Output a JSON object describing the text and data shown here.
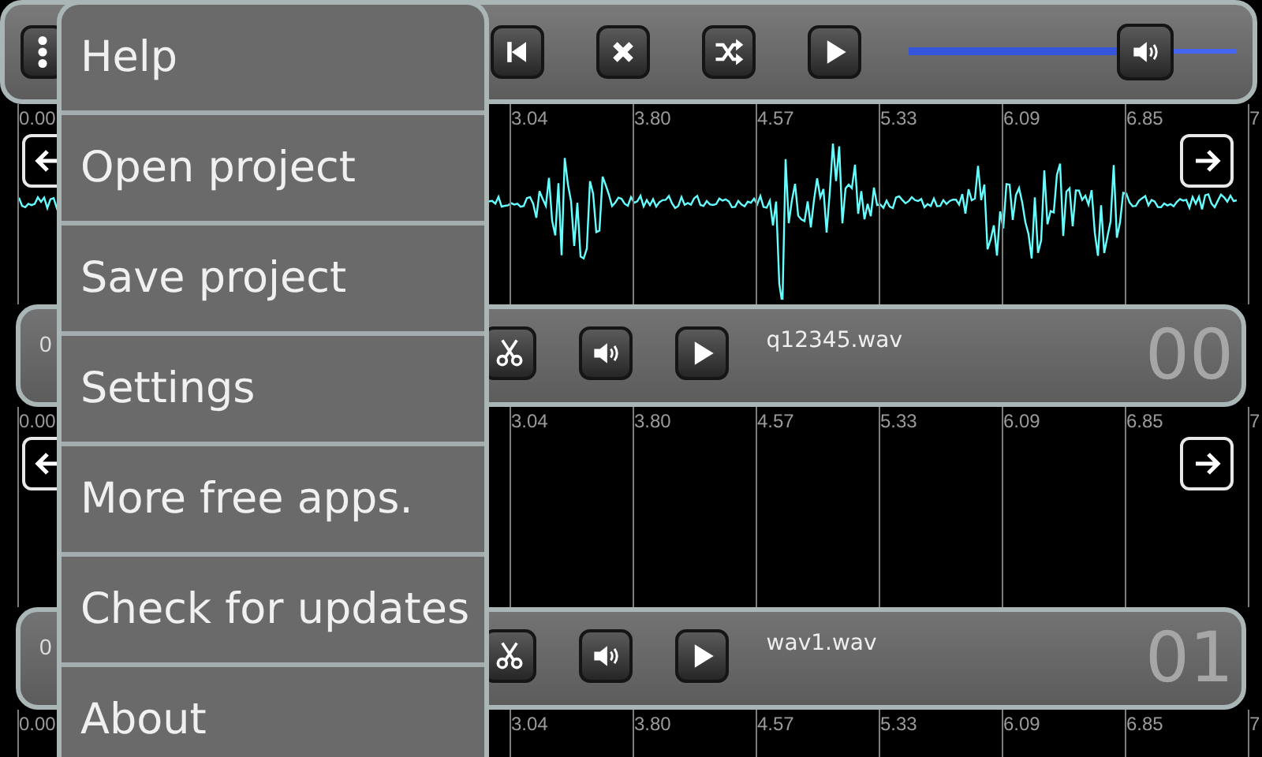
{
  "toolbar": {
    "buttons": [
      {
        "kind": "menu"
      },
      {
        "kind": "skip-back"
      },
      {
        "kind": "close"
      },
      {
        "kind": "shuffle"
      },
      {
        "kind": "play"
      }
    ],
    "volume": {
      "level": 0.72
    }
  },
  "sections": [
    {
      "ruler": {
        "ticks": [
          "0.00",
          "3.04",
          "3.80",
          "4.57",
          "5.33",
          "6.09",
          "6.85",
          "7"
        ]
      },
      "waveform": true,
      "track": {
        "index": "0",
        "buttons": [
          {
            "kind": "cut"
          },
          {
            "kind": "volume"
          },
          {
            "kind": "play"
          }
        ],
        "file": "q12345.wav",
        "number": "00"
      }
    },
    {
      "ruler": {
        "ticks": [
          "0.00",
          "3.04",
          "3.80",
          "4.57",
          "5.33",
          "6.09",
          "6.85",
          "7"
        ]
      },
      "waveform": false,
      "track": {
        "index": "0",
        "buttons": [
          {
            "kind": "cut"
          },
          {
            "kind": "volume"
          },
          {
            "kind": "play"
          }
        ],
        "file": "wav1.wav",
        "number": "01"
      }
    }
  ],
  "bottom_ruler": {
    "ticks": [
      "0.00",
      "3.04",
      "3.80",
      "4.57",
      "5.33",
      "6.09",
      "6.85",
      "7"
    ]
  },
  "menu": {
    "items": [
      {
        "label": "Help"
      },
      {
        "label": "Open project"
      },
      {
        "label": "Save project"
      },
      {
        "label": "Settings"
      },
      {
        "label": "More free apps."
      },
      {
        "label": "Check for updates"
      },
      {
        "label": "About"
      }
    ]
  }
}
